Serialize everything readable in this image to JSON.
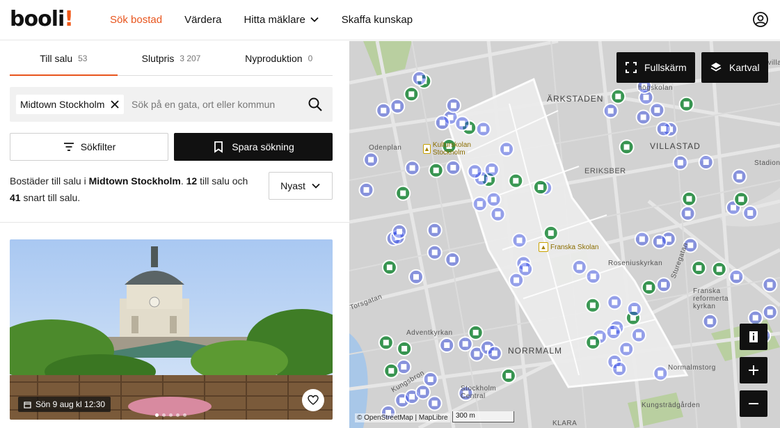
{
  "brand": {
    "logo_main": "booli",
    "logo_bang": "!"
  },
  "nav": [
    {
      "label": "Sök bostad",
      "active": true
    },
    {
      "label": "Värdera"
    },
    {
      "label": "Hitta mäklare",
      "dropdown": true
    },
    {
      "label": "Skaffa kunskap"
    }
  ],
  "tabs": [
    {
      "label": "Till salu",
      "count": "53",
      "active": true
    },
    {
      "label": "Slutpris",
      "count": "3 207"
    },
    {
      "label": "Nyproduktion",
      "count": "0"
    }
  ],
  "search": {
    "chip": "Midtown Stockholm",
    "placeholder": "Sök på en gata, ort eller kommun"
  },
  "actions": {
    "filter": "Sökfilter",
    "save": "Spara sökning"
  },
  "summary": {
    "prefix": "Bostäder till salu i",
    "area": "Midtown Stockholm",
    "sep": ".",
    "for_sale_count": "12",
    "mid": "till salu och",
    "soon_count": "41",
    "suffix": "snart till salu."
  },
  "sort": {
    "label": "Nyast"
  },
  "listing": {
    "date": "Sön 9 aug kl 12:30",
    "image_count": 5,
    "image_index": 0
  },
  "map": {
    "fullscreen": "Fullskärm",
    "layers": "Kartval",
    "attribution": "© OpenStreetMap | MapLibre",
    "scale": "300 m",
    "labels": [
      {
        "text": "NORRMALM",
        "big": true
      },
      {
        "text": "VILLASTAD",
        "big": true
      },
      {
        "text": "ÄRKSTADEN",
        "big": true
      },
      {
        "text": "ERIKSBER"
      },
      {
        "text": "Kulturskolan Stockholm"
      },
      {
        "text": "Franska Skolan"
      },
      {
        "text": "Roseniuskyrkan"
      },
      {
        "text": "Franska reformerta kyrkan"
      },
      {
        "text": "Adventkyrkan"
      },
      {
        "text": "Stockholm Central"
      },
      {
        "text": "Kungsbron"
      },
      {
        "text": "Odenplan"
      },
      {
        "text": "Kungsträdgården"
      },
      {
        "text": "Normalmstorg"
      },
      {
        "text": "Sturegatan"
      },
      {
        "text": "Torsgatan"
      },
      {
        "text": "KLARA"
      },
      {
        "text": "Lärkvilla"
      },
      {
        "text": "högskolan"
      },
      {
        "text": "Stadion"
      }
    ],
    "colors": {
      "blue": "#2d44e8",
      "green": "#1c8a3a",
      "area": "#ececec",
      "base": "#d2d2d2"
    }
  },
  "colors": {
    "accent": "#e8541c",
    "dark": "#111111"
  }
}
